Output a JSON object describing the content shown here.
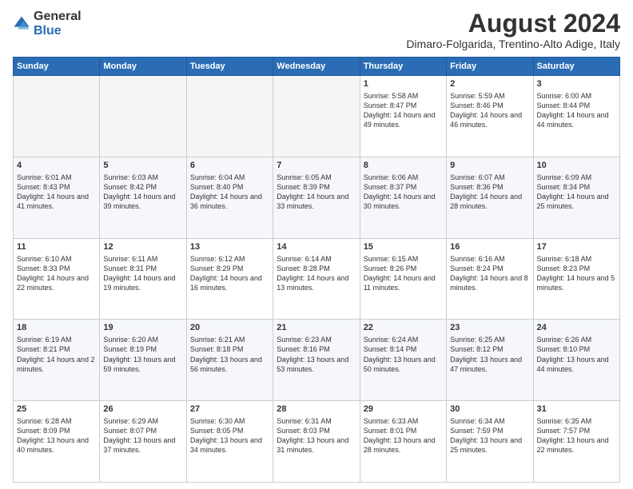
{
  "logo": {
    "general": "General",
    "blue": "Blue"
  },
  "title": "August 2024",
  "location": "Dimaro-Folgarida, Trentino-Alto Adige, Italy",
  "days_of_week": [
    "Sunday",
    "Monday",
    "Tuesday",
    "Wednesday",
    "Thursday",
    "Friday",
    "Saturday"
  ],
  "weeks": [
    [
      {
        "day": "",
        "info": ""
      },
      {
        "day": "",
        "info": ""
      },
      {
        "day": "",
        "info": ""
      },
      {
        "day": "",
        "info": ""
      },
      {
        "day": "1",
        "info": "Sunrise: 5:58 AM\nSunset: 8:47 PM\nDaylight: 14 hours and 49 minutes."
      },
      {
        "day": "2",
        "info": "Sunrise: 5:59 AM\nSunset: 8:46 PM\nDaylight: 14 hours and 46 minutes."
      },
      {
        "day": "3",
        "info": "Sunrise: 6:00 AM\nSunset: 8:44 PM\nDaylight: 14 hours and 44 minutes."
      }
    ],
    [
      {
        "day": "4",
        "info": "Sunrise: 6:01 AM\nSunset: 8:43 PM\nDaylight: 14 hours and 41 minutes."
      },
      {
        "day": "5",
        "info": "Sunrise: 6:03 AM\nSunset: 8:42 PM\nDaylight: 14 hours and 39 minutes."
      },
      {
        "day": "6",
        "info": "Sunrise: 6:04 AM\nSunset: 8:40 PM\nDaylight: 14 hours and 36 minutes."
      },
      {
        "day": "7",
        "info": "Sunrise: 6:05 AM\nSunset: 8:39 PM\nDaylight: 14 hours and 33 minutes."
      },
      {
        "day": "8",
        "info": "Sunrise: 6:06 AM\nSunset: 8:37 PM\nDaylight: 14 hours and 30 minutes."
      },
      {
        "day": "9",
        "info": "Sunrise: 6:07 AM\nSunset: 8:36 PM\nDaylight: 14 hours and 28 minutes."
      },
      {
        "day": "10",
        "info": "Sunrise: 6:09 AM\nSunset: 8:34 PM\nDaylight: 14 hours and 25 minutes."
      }
    ],
    [
      {
        "day": "11",
        "info": "Sunrise: 6:10 AM\nSunset: 8:33 PM\nDaylight: 14 hours and 22 minutes."
      },
      {
        "day": "12",
        "info": "Sunrise: 6:11 AM\nSunset: 8:31 PM\nDaylight: 14 hours and 19 minutes."
      },
      {
        "day": "13",
        "info": "Sunrise: 6:12 AM\nSunset: 8:29 PM\nDaylight: 14 hours and 16 minutes."
      },
      {
        "day": "14",
        "info": "Sunrise: 6:14 AM\nSunset: 8:28 PM\nDaylight: 14 hours and 13 minutes."
      },
      {
        "day": "15",
        "info": "Sunrise: 6:15 AM\nSunset: 8:26 PM\nDaylight: 14 hours and 11 minutes."
      },
      {
        "day": "16",
        "info": "Sunrise: 6:16 AM\nSunset: 8:24 PM\nDaylight: 14 hours and 8 minutes."
      },
      {
        "day": "17",
        "info": "Sunrise: 6:18 AM\nSunset: 8:23 PM\nDaylight: 14 hours and 5 minutes."
      }
    ],
    [
      {
        "day": "18",
        "info": "Sunrise: 6:19 AM\nSunset: 8:21 PM\nDaylight: 14 hours and 2 minutes."
      },
      {
        "day": "19",
        "info": "Sunrise: 6:20 AM\nSunset: 8:19 PM\nDaylight: 13 hours and 59 minutes."
      },
      {
        "day": "20",
        "info": "Sunrise: 6:21 AM\nSunset: 8:18 PM\nDaylight: 13 hours and 56 minutes."
      },
      {
        "day": "21",
        "info": "Sunrise: 6:23 AM\nSunset: 8:16 PM\nDaylight: 13 hours and 53 minutes."
      },
      {
        "day": "22",
        "info": "Sunrise: 6:24 AM\nSunset: 8:14 PM\nDaylight: 13 hours and 50 minutes."
      },
      {
        "day": "23",
        "info": "Sunrise: 6:25 AM\nSunset: 8:12 PM\nDaylight: 13 hours and 47 minutes."
      },
      {
        "day": "24",
        "info": "Sunrise: 6:26 AM\nSunset: 8:10 PM\nDaylight: 13 hours and 44 minutes."
      }
    ],
    [
      {
        "day": "25",
        "info": "Sunrise: 6:28 AM\nSunset: 8:09 PM\nDaylight: 13 hours and 40 minutes."
      },
      {
        "day": "26",
        "info": "Sunrise: 6:29 AM\nSunset: 8:07 PM\nDaylight: 13 hours and 37 minutes."
      },
      {
        "day": "27",
        "info": "Sunrise: 6:30 AM\nSunset: 8:05 PM\nDaylight: 13 hours and 34 minutes."
      },
      {
        "day": "28",
        "info": "Sunrise: 6:31 AM\nSunset: 8:03 PM\nDaylight: 13 hours and 31 minutes."
      },
      {
        "day": "29",
        "info": "Sunrise: 6:33 AM\nSunset: 8:01 PM\nDaylight: 13 hours and 28 minutes."
      },
      {
        "day": "30",
        "info": "Sunrise: 6:34 AM\nSunset: 7:59 PM\nDaylight: 13 hours and 25 minutes."
      },
      {
        "day": "31",
        "info": "Sunrise: 6:35 AM\nSunset: 7:57 PM\nDaylight: 13 hours and 22 minutes."
      }
    ]
  ]
}
